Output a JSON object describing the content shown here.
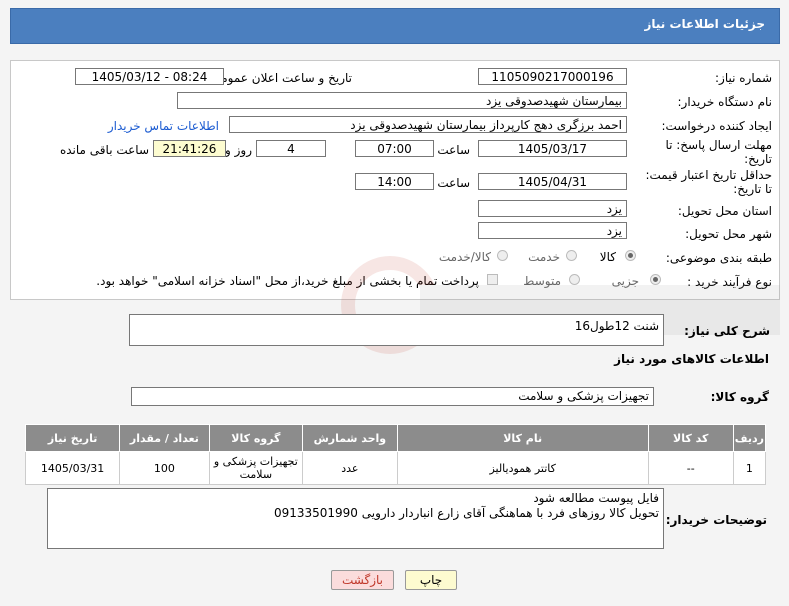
{
  "header": {
    "title": "جزئیات اطلاعات نیاز"
  },
  "fields": {
    "need_number_label": "شماره نیاز:",
    "need_number": "1105090217000196",
    "announce_label": "تاریخ و ساعت اعلان عمومی:",
    "announce_value": "1405/03/12 - 08:24",
    "buyer_label": "نام دستگاه خریدار:",
    "buyer_value": "بیمارستان شهیدصدوقی یزد",
    "creator_label": "ایجاد کننده درخواست:",
    "creator_value": "احمد برزگری دهج کارپرداز بیمارستان شهیدصدوقی یزد",
    "contact_link": "اطلاعات تماس خریدار",
    "deadline_label_1": "مهلت ارسال پاسخ: تا",
    "deadline_label_2": "تاریخ:",
    "deadline_date": "1405/03/17",
    "time_label": "ساعت",
    "deadline_time": "07:00",
    "days_value": "4",
    "days_label": "روز و",
    "remaining_time": "21:41:26",
    "remaining_label": "ساعت باقی مانده",
    "validity_label_1": "حداقل تاریخ اعتبار قیمت:",
    "validity_label_2": "تا تاریخ:",
    "validity_date": "1405/04/31",
    "validity_time": "14:00",
    "province_label": "استان محل تحویل:",
    "province_value": "یزد",
    "city_label": "شهر محل تحویل:",
    "city_value": "یزد",
    "category_label": "طبقه بندی موضوعی:",
    "cat_goods": "کالا",
    "cat_service": "خدمت",
    "cat_goods_service": "کالا/خدمت",
    "process_label": "نوع فرآیند خرید :",
    "proc_minor": "جزیی",
    "proc_medium": "متوسط",
    "payment_note": "پرداخت تمام یا بخشی از مبلغ خرید،از محل \"اسناد خزانه اسلامی\" خواهد بود."
  },
  "description": {
    "label": "شرح کلی نیاز:",
    "value": "شنت 12طول16"
  },
  "goods_section": {
    "title": "اطلاعات کالاهای مورد نیاز",
    "group_label": "گروه کالا:",
    "group_value": "تجهیزات پزشکی و سلامت"
  },
  "table": {
    "headers": [
      "ردیف",
      "کد کالا",
      "نام کالا",
      "واحد شمارش",
      "گروه کالا",
      "تعداد / مقدار",
      "تاریخ نیاز"
    ],
    "rows": [
      [
        "1",
        "--",
        "کاتتر همودیالیز",
        "عدد",
        "تجهیزات پزشکی و سلامت",
        "100",
        "1405/03/31"
      ]
    ]
  },
  "buyer_notes": {
    "label": "توضیحات خریدار:",
    "line1": "فایل پیوست مطالعه شود",
    "line2": "تحویل کالا روزهای فرد با هماهنگی آقای زارع انباردار دارویی 09133501990"
  },
  "buttons": {
    "print": "چاپ",
    "back": "بازگشت"
  },
  "colors": {
    "header_bg": "#4b7fbf",
    "table_header_bg": "#8c8c8c",
    "link": "#1b5bd1",
    "back_text": "#c0392b"
  },
  "watermark_icon": "aria-tender-logo"
}
